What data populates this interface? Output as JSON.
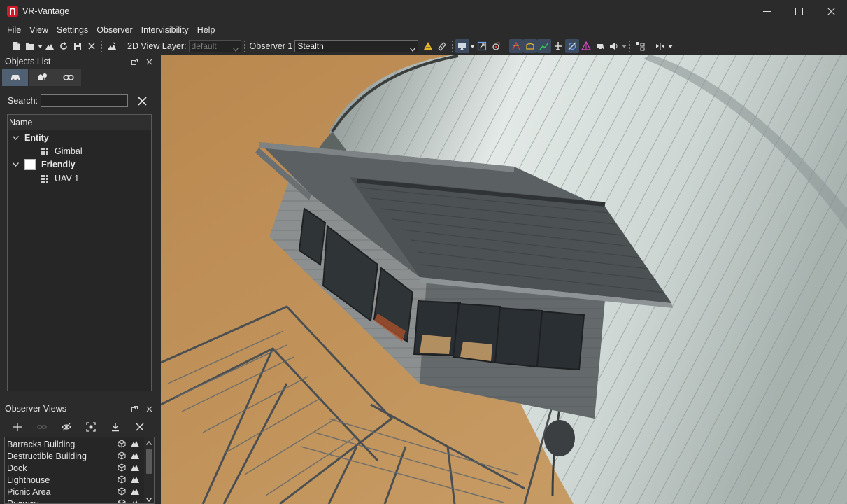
{
  "window": {
    "title": "VR-Vantage"
  },
  "menu": [
    "File",
    "View",
    "Settings",
    "Observer",
    "Intervisibility",
    "Help"
  ],
  "toolbar": {
    "view_layer_label": "2D View Layer:",
    "view_layer_value": "default",
    "observer_label": "Observer 1",
    "observer_value": "Stealth"
  },
  "objects_list": {
    "title": "Objects List",
    "search_label": "Search:",
    "search_value": "",
    "column_header": "Name",
    "tree": [
      {
        "label": "Entity",
        "children": [
          "Gimbal"
        ]
      },
      {
        "label": "Friendly",
        "children": [
          "UAV 1"
        ]
      }
    ]
  },
  "observer_views": {
    "title": "Observer Views",
    "items": [
      "Barracks Building",
      "Destructible Building",
      "Dock",
      "Lighthouse",
      "Picnic Area",
      "Runway"
    ]
  },
  "colors": {
    "app_accent": "#d21b2a",
    "active_tab": "#4f6072",
    "ground": "#c19259"
  },
  "icons": {
    "toolbar": [
      "new-file-icon",
      "open-folder-icon",
      "terrain-icon",
      "refresh-icon",
      "save-icon",
      "close-icon",
      "terrain-edit-icon",
      "warning-triangle-icon",
      "ruler-icon",
      "observer-mode-icon",
      "fit-view-icon",
      "target-icon",
      "los-icon",
      "path-icon",
      "graph-icon",
      "aircraft-icon",
      "visibility-icon",
      "cone-icon",
      "vehicle-icon",
      "audio-icon",
      "layout-icon",
      "split-view-icon"
    ]
  }
}
